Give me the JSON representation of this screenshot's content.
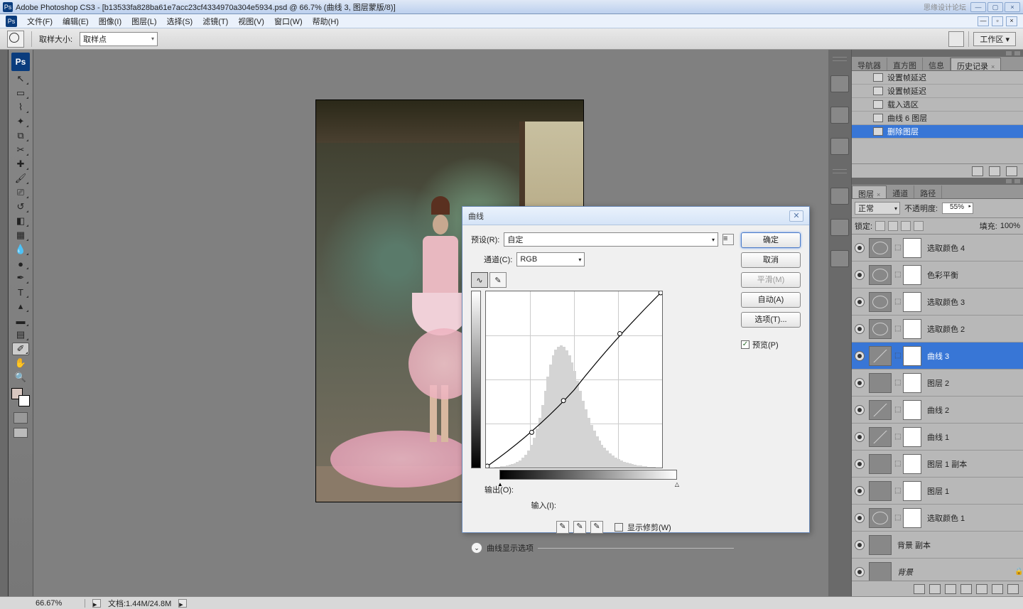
{
  "titlebar": {
    "app": "Adobe Photoshop CS3",
    "doc": "[b13533fa828ba61e7acc23cf4334970a304e5934.psd @ 66.7% (曲线 3, 图层蒙版/8)]",
    "watermark": "思缘设计论坛"
  },
  "menu": {
    "file": "文件(F)",
    "edit": "编辑(E)",
    "image": "图像(I)",
    "layer": "图层(L)",
    "select": "选择(S)",
    "filter": "滤镜(T)",
    "view": "视图(V)",
    "window": "窗口(W)",
    "help": "帮助(H)"
  },
  "options": {
    "sampleSizeLabel": "取样大小:",
    "sampleSizeValue": "取样点",
    "workspace": "工作区 ▾"
  },
  "historyTabs": {
    "nav": "导航器",
    "histo": "直方图",
    "info": "信息",
    "history": "历史记录"
  },
  "history": [
    {
      "label": "设置帧延迟"
    },
    {
      "label": "设置帧延迟"
    },
    {
      "label": "载入选区"
    },
    {
      "label": "曲线 6 图层"
    },
    {
      "label": "删除图层",
      "sel": true
    }
  ],
  "layersTabs": {
    "layers": "图层",
    "channels": "通道",
    "paths": "路径"
  },
  "layerOpts": {
    "blend": "正常",
    "opacityLabel": "不透明度:",
    "opacity": "55%",
    "lockLabel": "锁定:",
    "fillLabel": "填充:",
    "fill": "100%"
  },
  "layers": [
    {
      "name": "选取颜色 4",
      "type": "adj"
    },
    {
      "name": "色彩平衡",
      "type": "adj"
    },
    {
      "name": "选取颜色 3",
      "type": "adj"
    },
    {
      "name": "选取颜色 2",
      "type": "adj"
    },
    {
      "name": "曲线 3",
      "type": "curves",
      "sel": true,
      "maskImg": true
    },
    {
      "name": "图层 2",
      "type": "img"
    },
    {
      "name": "曲线 2",
      "type": "curves"
    },
    {
      "name": "曲线 1",
      "type": "curves",
      "gradMask": true
    },
    {
      "name": "图层 1 副本",
      "type": "img"
    },
    {
      "name": "图层 1",
      "type": "img",
      "blackMask": true
    },
    {
      "name": "选取颜色 1",
      "type": "adj"
    },
    {
      "name": "背景 副本",
      "type": "img",
      "noMask": true
    },
    {
      "name": "背景",
      "type": "img",
      "noMask": true,
      "italic": true,
      "locked": true
    }
  ],
  "dialog": {
    "title": "曲线",
    "presetLabel": "预设(R):",
    "preset": "自定",
    "channelLabel": "通道(C):",
    "channel": "RGB",
    "outputLabel": "输出(O):",
    "inputLabel": "输入(I):",
    "showClip": "显示修剪(W)",
    "expand": "曲线显示选项",
    "ok": "确定",
    "cancel": "取消",
    "smooth": "平滑(M)",
    "auto": "自动(A)",
    "opts": "选项(T)...",
    "preview": "预览(P)"
  },
  "status": {
    "zoom": "66.67%",
    "doc": "文档:1.44M/24.8M"
  }
}
